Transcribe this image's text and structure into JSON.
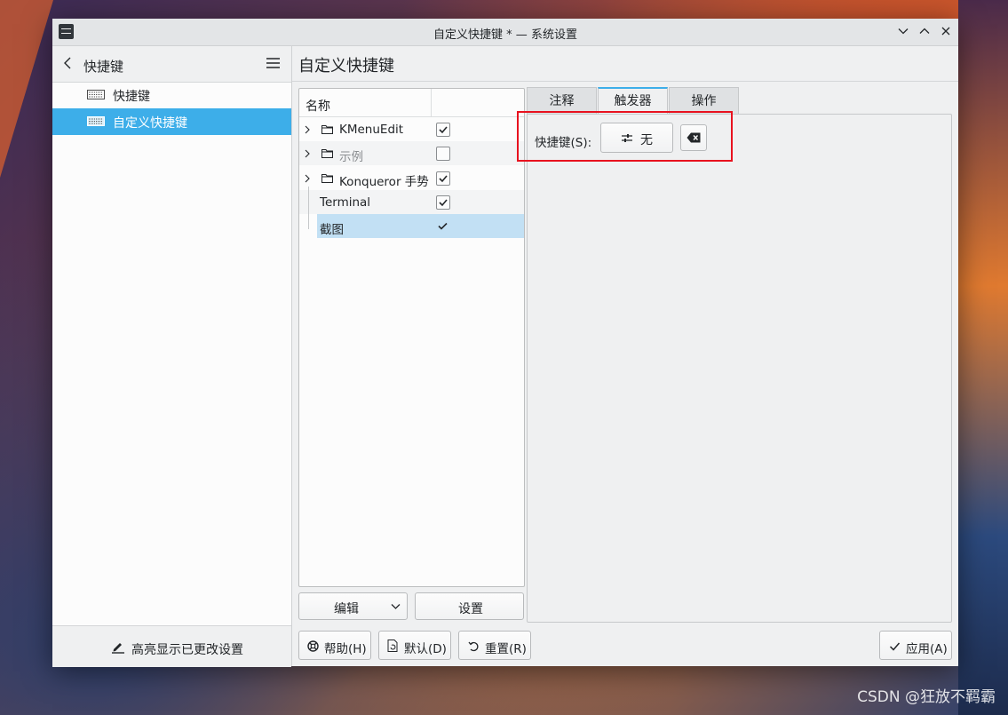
{
  "window": {
    "title": "自定义快捷键 * — 系统设置",
    "controls": [
      "chevron-down-icon",
      "chevron-up-icon",
      "close-icon"
    ]
  },
  "sidebar": {
    "header_title": "快捷键",
    "items": [
      {
        "label": "快捷键",
        "icon": "keyboard-icon",
        "selected": false
      },
      {
        "label": "自定义快捷键",
        "icon": "keyboard-icon",
        "selected": true
      }
    ],
    "footer_label": "高亮显示已更改设置"
  },
  "main": {
    "title": "自定义快捷键",
    "tree": {
      "column_header": "名称",
      "rows": [
        {
          "label": "KMenuEdit",
          "type": "folder",
          "checked": true,
          "enabled": true
        },
        {
          "label": "示例",
          "type": "folder",
          "checked": false,
          "enabled": false
        },
        {
          "label": "Konqueror 手势",
          "type": "folder",
          "checked": true,
          "enabled": true
        },
        {
          "label": "Terminal",
          "type": "item",
          "checked": true,
          "enabled": true
        },
        {
          "label": "截图",
          "type": "item",
          "checked": true,
          "enabled": true,
          "selected": true
        }
      ]
    },
    "edit_button": "编辑",
    "settings_button": "设置",
    "tabs": [
      {
        "label": "注释",
        "active": false
      },
      {
        "label": "触发器",
        "active": true
      },
      {
        "label": "操作",
        "active": false
      }
    ],
    "trigger": {
      "shortcut_label": "快捷键(S):",
      "shortcut_value": "无"
    }
  },
  "footer": {
    "help": "帮助(H)",
    "defaults": "默认(D)",
    "reset": "重置(R)",
    "apply": "应用(A)"
  },
  "watermark": "CSDN @狂放不羁霸",
  "colors": {
    "accent": "#3daee9",
    "highlight_box": "#e8121f"
  }
}
